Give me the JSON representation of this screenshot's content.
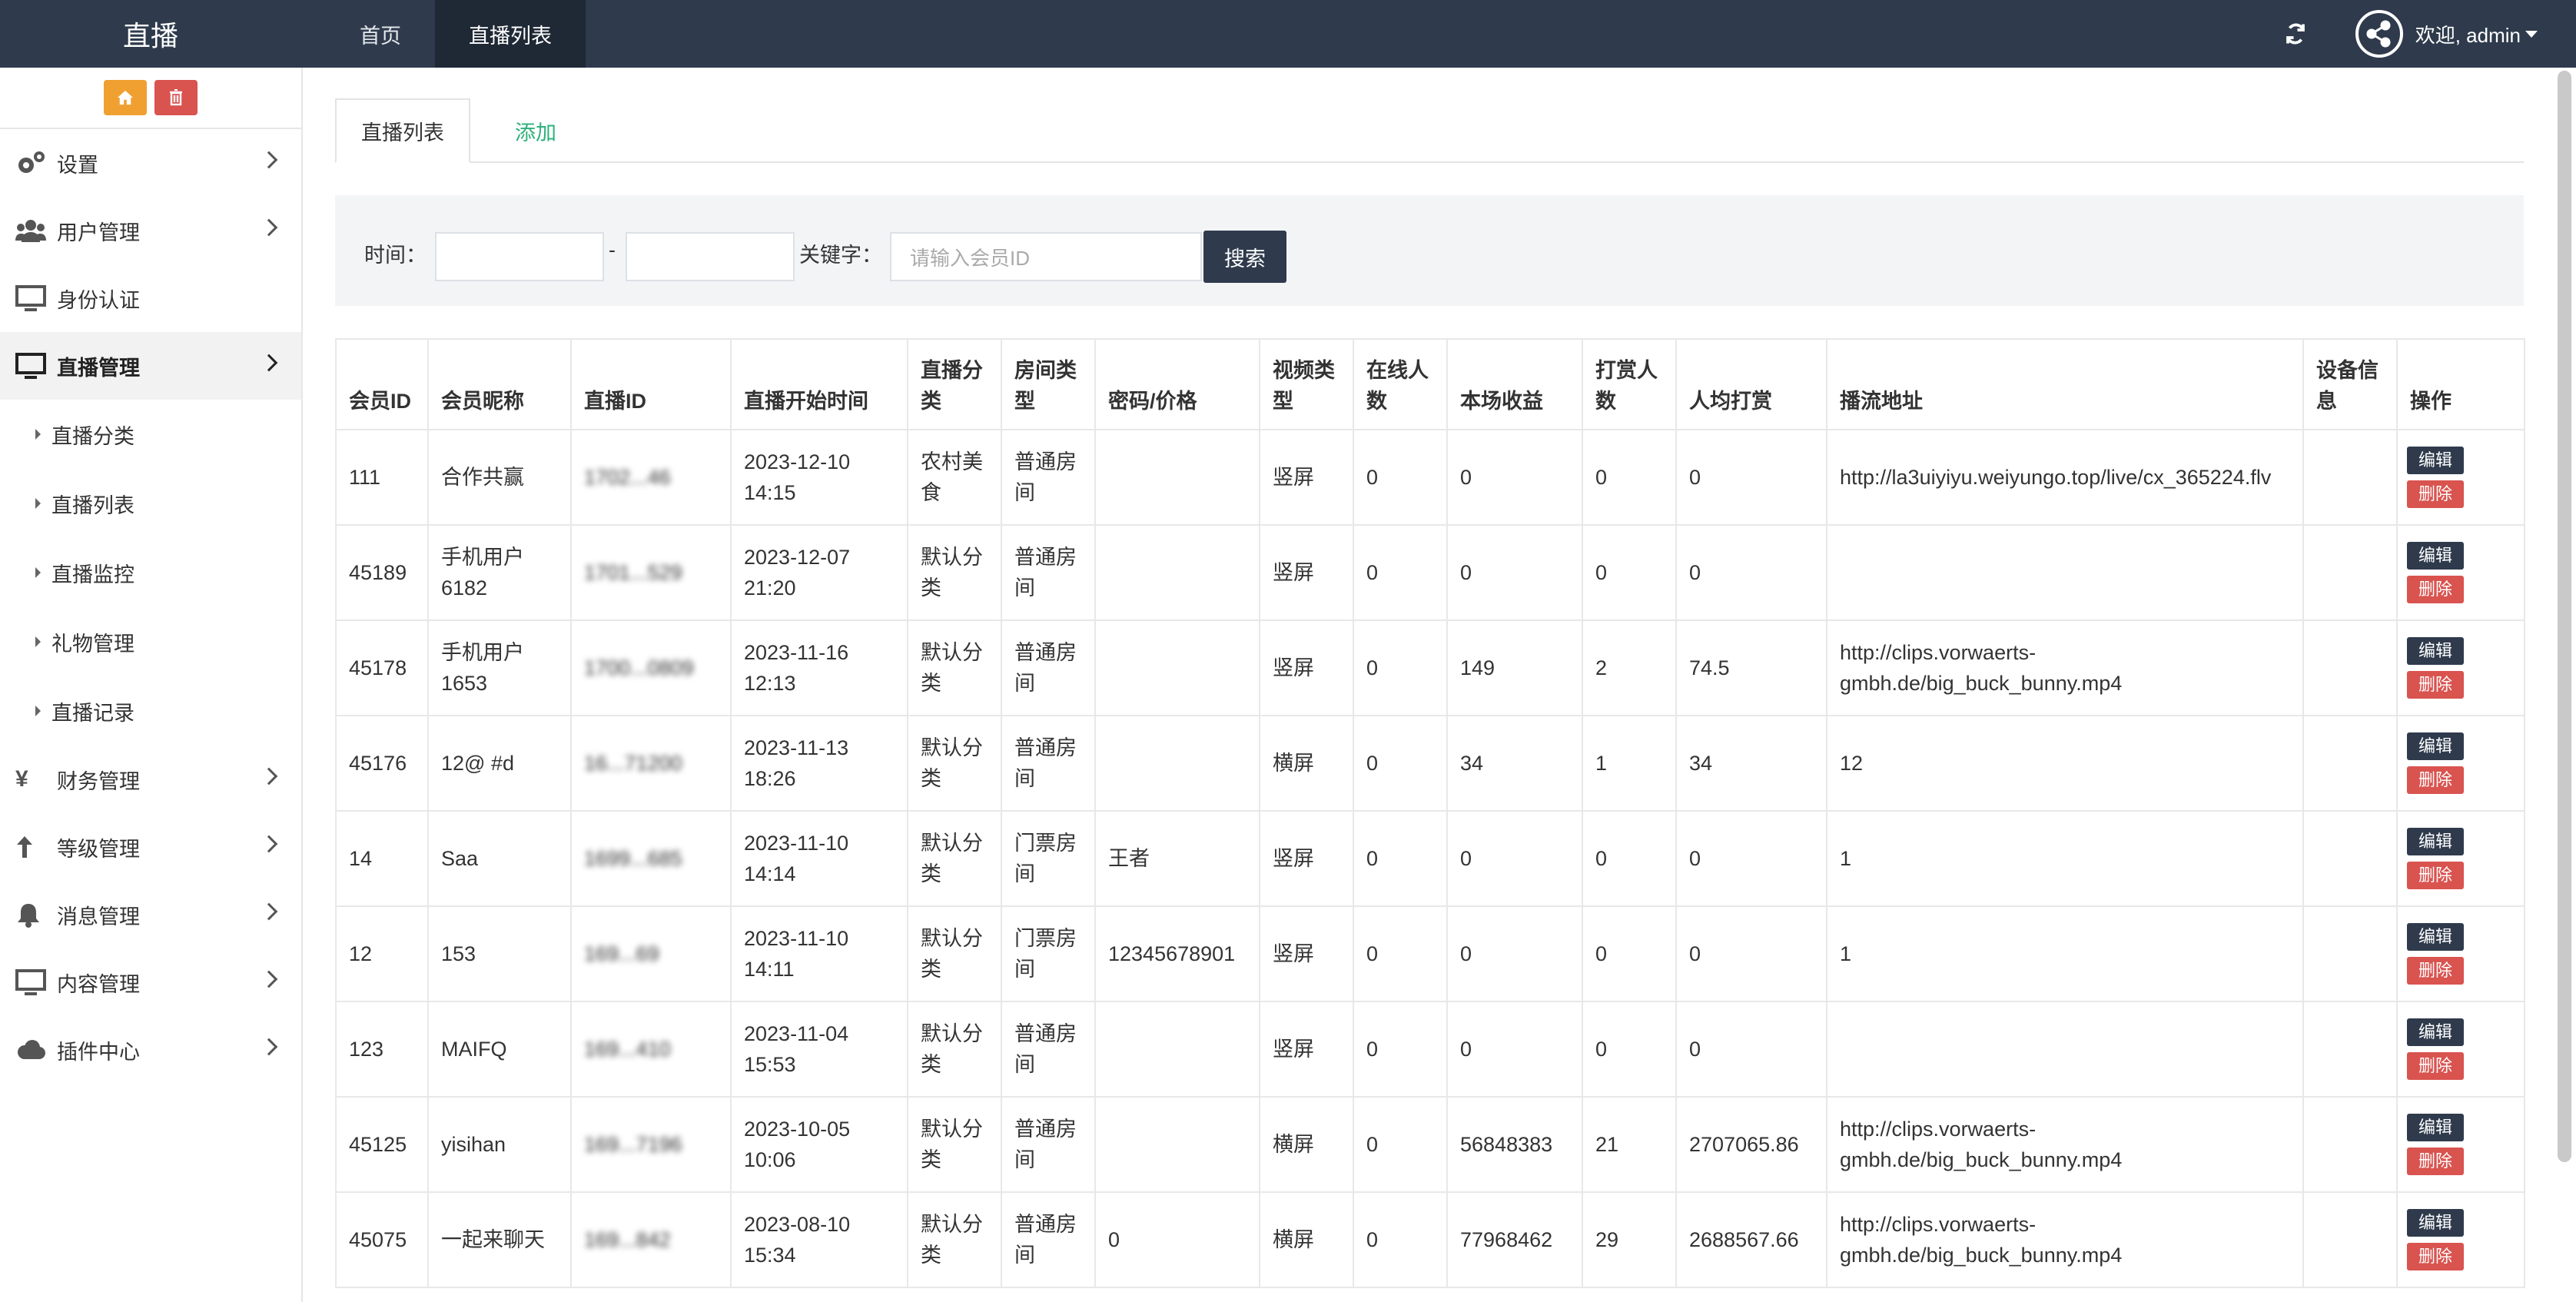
{
  "header": {
    "brand": "直播",
    "nav": [
      {
        "label": "首页"
      },
      {
        "label": "直播列表"
      }
    ],
    "welcome": "欢迎, admin"
  },
  "sidebar": {
    "menu": [
      {
        "label": "设置",
        "icon": "gear-icon"
      },
      {
        "label": "用户管理",
        "icon": "users-icon"
      },
      {
        "label": "身份认证",
        "icon": "monitor-icon"
      },
      {
        "label": "直播管理",
        "icon": "monitor-icon"
      }
    ],
    "submenu": [
      {
        "label": "直播分类"
      },
      {
        "label": "直播列表"
      },
      {
        "label": "直播监控"
      },
      {
        "label": "礼物管理"
      },
      {
        "label": "直播记录"
      }
    ],
    "menu2": [
      {
        "label": "财务管理",
        "icon": "yen-icon"
      },
      {
        "label": "等级管理",
        "icon": "upload-icon"
      },
      {
        "label": "消息管理",
        "icon": "bell-icon"
      },
      {
        "label": "内容管理",
        "icon": "monitor-icon"
      },
      {
        "label": "插件中心",
        "icon": "cloud-icon"
      }
    ]
  },
  "tabs": {
    "list": "直播列表",
    "add": "添加"
  },
  "filter": {
    "time_label": "时间：",
    "dash": "-",
    "keyword_label": "关键字：",
    "keyword_placeholder": "请输入会员ID",
    "search_label": "搜索"
  },
  "table": {
    "headers": [
      "会员ID",
      "会员昵称",
      "直播ID",
      "直播开始时间",
      "直播分类",
      "房间类型",
      "密码/价格",
      "视频类型",
      "在线人数",
      "本场收益",
      "打赏人数",
      "人均打赏",
      "播流地址",
      "设备信息",
      "操作"
    ],
    "edit_label": "编辑",
    "delete_label": "删除",
    "rows": [
      {
        "uid": "111",
        "nick": "合作共赢",
        "liveid": "1702...46",
        "start": "2023-12-10 14:15",
        "cat": "农村美食",
        "room": "普通房间",
        "pwd": "",
        "video": "竖屏",
        "online": "0",
        "income": "0",
        "givers": "0",
        "avg": "0",
        "url": "http://la3uiyiyu.weiyungo.top/live/cx_365224.flv",
        "device": ""
      },
      {
        "uid": "45189",
        "nick": "手机用户6182",
        "liveid": "1701...529",
        "start": "2023-12-07 21:20",
        "cat": "默认分类",
        "room": "普通房间",
        "pwd": "",
        "video": "竖屏",
        "online": "0",
        "income": "0",
        "givers": "0",
        "avg": "0",
        "url": "",
        "device": ""
      },
      {
        "uid": "45178",
        "nick": "手机用户1653",
        "liveid": "1700...0809",
        "start": "2023-11-16 12:13",
        "cat": "默认分类",
        "room": "普通房间",
        "pwd": "",
        "video": "竖屏",
        "online": "0",
        "income": "149",
        "givers": "2",
        "avg": "74.5",
        "url": "http://clips.vorwaerts-gmbh.de/big_buck_bunny.mp4",
        "device": ""
      },
      {
        "uid": "45176",
        "nick": "12@ #d",
        "liveid": "16...71200",
        "start": "2023-11-13 18:26",
        "cat": "默认分类",
        "room": "普通房间",
        "pwd": "",
        "video": "横屏",
        "online": "0",
        "income": "34",
        "givers": "1",
        "avg": "34",
        "url": "12",
        "device": ""
      },
      {
        "uid": "14",
        "nick": "Saa",
        "liveid": "1699...685",
        "start": "2023-11-10 14:14",
        "cat": "默认分类",
        "room": "门票房间",
        "pwd": "王者",
        "video": "竖屏",
        "online": "0",
        "income": "0",
        "givers": "0",
        "avg": "0",
        "url": "1",
        "device": ""
      },
      {
        "uid": "12",
        "nick": "153",
        "liveid": "169...69",
        "start": "2023-11-10 14:11",
        "cat": "默认分类",
        "room": "门票房间",
        "pwd": "12345678901",
        "video": "竖屏",
        "online": "0",
        "income": "0",
        "givers": "0",
        "avg": "0",
        "url": "1",
        "device": ""
      },
      {
        "uid": "123",
        "nick": "MAIFQ",
        "liveid": "169...410",
        "start": "2023-11-04 15:53",
        "cat": "默认分类",
        "room": "普通房间",
        "pwd": "",
        "video": "竖屏",
        "online": "0",
        "income": "0",
        "givers": "0",
        "avg": "0",
        "url": "",
        "device": ""
      },
      {
        "uid": "45125",
        "nick": "yisihan",
        "liveid": "169...7196",
        "start": "2023-10-05 10:06",
        "cat": "默认分类",
        "room": "普通房间",
        "pwd": "",
        "video": "横屏",
        "online": "0",
        "income": "56848383",
        "givers": "21",
        "avg": "2707065.86",
        "url": "http://clips.vorwaerts-gmbh.de/big_buck_bunny.mp4",
        "device": ""
      },
      {
        "uid": "45075",
        "nick": "一起来聊天",
        "liveid": "169...842",
        "start": "2023-08-10 15:34",
        "cat": "默认分类",
        "room": "普通房间",
        "pwd": "0",
        "video": "横屏",
        "online": "0",
        "income": "77968462",
        "givers": "29",
        "avg": "2688567.66",
        "url": "http://clips.vorwaerts-gmbh.de/big_buck_bunny.mp4",
        "device": ""
      }
    ]
  }
}
